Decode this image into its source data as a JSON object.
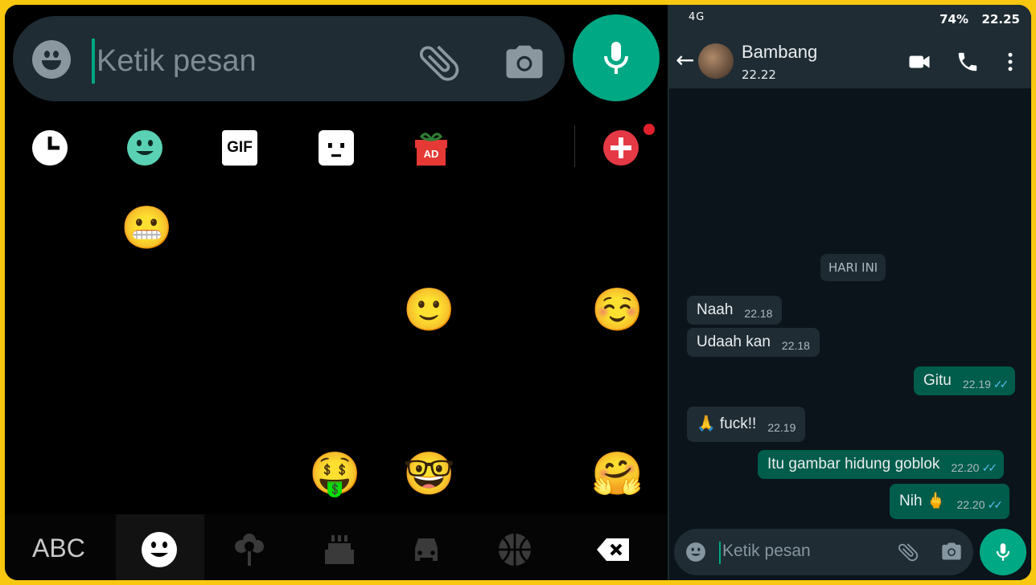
{
  "keyboard": {
    "input_placeholder": "Ketik pesan",
    "categories": [
      {
        "name": "recent-icon"
      },
      {
        "name": "smiley-category-icon"
      },
      {
        "name": "gif-icon",
        "label": "GIF"
      },
      {
        "name": "sticker-icon"
      },
      {
        "name": "ad-gift-icon",
        "label": "AD"
      },
      {
        "name": "add-icon"
      }
    ],
    "emoji_rows": [
      [
        "😀",
        "😬",
        "😁",
        "😂",
        "😃",
        "😄",
        "😅"
      ],
      [
        "😆",
        "😇",
        "😉",
        "😊",
        "🙂",
        "🙃",
        "☺️"
      ],
      [
        "😋",
        "😌",
        "😍",
        "😘",
        "😗",
        "😙",
        "😚"
      ],
      [
        "😜",
        "😝",
        "😛",
        "🤑",
        "🤓",
        "😎",
        "🤗"
      ]
    ],
    "bottom": {
      "abc_label": "ABC"
    }
  },
  "chat": {
    "status_bar": {
      "signal": "4G",
      "battery": "74%",
      "time": "22.25"
    },
    "contact_name": "Bambang",
    "last_seen": "22.22",
    "day_label": "HARI INI",
    "messages": [
      {
        "dir": "in",
        "text": "Naah",
        "time": "22.18"
      },
      {
        "dir": "in",
        "text": "Udaah kan",
        "time": "22.18"
      },
      {
        "dir": "out",
        "text": "Gitu",
        "time": "22.19"
      },
      {
        "dir": "in",
        "text": "🙏 fuck!!",
        "time": "22.19"
      },
      {
        "dir": "out",
        "text": "Itu gambar hidung goblok",
        "time": "22.20"
      },
      {
        "dir": "out",
        "text": "Nih 🖕",
        "time": "22.20"
      }
    ],
    "input_placeholder": "Ketik pesan"
  },
  "colors": {
    "accent": "#00a884",
    "bar": "#1f2c34",
    "outgoing": "#005c4b",
    "frame": "#f7c80f"
  }
}
